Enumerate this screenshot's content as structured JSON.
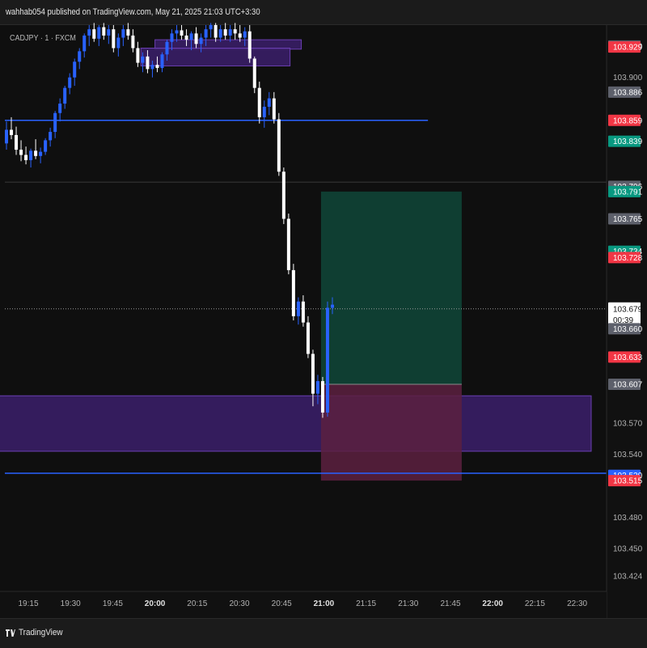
{
  "header": {
    "published": "wahhab054 published on TradingView.com, May 21, 2025 21:03 UTC+3:30"
  },
  "symbol": {
    "label": "CADJPY · 1 · FXCM"
  },
  "footer": {
    "brand": "TradingView",
    "logo_icon": "tradingview-logo-icon"
  },
  "colors": {
    "background": "#0f0f0f",
    "bull": "#2962ff",
    "bear": "#ffffff",
    "level_line": "#2962ff",
    "zone": "#3b1e6b",
    "zone_border": "#6a3fb0",
    "profit": "#0f4638",
    "loss": "#5c2040",
    "tag_red": "#f23645",
    "tag_green": "#089981",
    "tag_gray": "#5d606b",
    "tag_blue": "#2962ff"
  },
  "chart_data": {
    "type": "candlestick",
    "symbol": "CADJPY",
    "interval": "1",
    "source": "FXCM",
    "ylim": [
      103.41,
      103.95
    ],
    "x_ticks": [
      "19:15",
      "19:30",
      "19:45",
      "20:00",
      "20:15",
      "20:30",
      "20:45",
      "21:00",
      "21:15",
      "21:30",
      "21:45",
      "22:00",
      "22:15",
      "22:30"
    ],
    "x_ticks_bold": [
      "20:00",
      "21:00",
      "22:00"
    ],
    "y_ticks": [
      103.9,
      103.57,
      103.54,
      103.48,
      103.45,
      103.424
    ],
    "price_tags": [
      {
        "value": 103.93,
        "label": "103.930",
        "style": "gray"
      },
      {
        "value": 103.929,
        "label": "103.929",
        "style": "red"
      },
      {
        "value": 103.886,
        "label": "103.886",
        "style": "gray"
      },
      {
        "value": 103.859,
        "label": "103.859",
        "style": "red"
      },
      {
        "value": 103.839,
        "label": "103.839",
        "style": "green"
      },
      {
        "value": 103.796,
        "label": "103.796",
        "style": "gray"
      },
      {
        "value": 103.791,
        "label": "103.791",
        "style": "green"
      },
      {
        "value": 103.765,
        "label": "103.765",
        "style": "gray"
      },
      {
        "value": 103.734,
        "label": "103.734",
        "style": "green"
      },
      {
        "value": 103.728,
        "label": "103.728",
        "style": "red"
      },
      {
        "value": 103.679,
        "label": "103.679",
        "sub": "00:39",
        "style": "current"
      },
      {
        "value": 103.66,
        "label": "103.660",
        "style": "gray"
      },
      {
        "value": 103.633,
        "label": "103.633",
        "style": "red"
      },
      {
        "value": 103.607,
        "label": "103.607",
        "style": "gray"
      },
      {
        "value": 103.52,
        "label": "103.520",
        "style": "blue"
      },
      {
        "value": 103.515,
        "label": "103.515",
        "style": "red"
      }
    ],
    "horizontal_lines": [
      {
        "value": 103.859,
        "end_time": "21:37",
        "style": "blue"
      },
      {
        "value": 103.522,
        "end_time": "end",
        "style": "blue"
      },
      {
        "value": 103.8,
        "end_time": "end",
        "style": "gray-thin"
      },
      {
        "value": 103.679,
        "end_time": "end",
        "style": "dotted"
      }
    ],
    "zones": [
      {
        "t0": "20:00",
        "t1": "20:52",
        "top": 103.936,
        "bottom": 103.927
      },
      {
        "t0": "19:55",
        "t1": "20:48",
        "top": 103.928,
        "bottom": 103.911
      },
      {
        "t0": "18:58",
        "t1": "22:35",
        "top": 103.596,
        "bottom": 103.543
      }
    ],
    "position": {
      "side": "long",
      "t0": "20:59",
      "t1": "21:49",
      "entry": 103.607,
      "target": 103.791,
      "stop": 103.515
    },
    "candles": [
      [
        103.837,
        103.858,
        103.831,
        103.85
      ],
      [
        103.85,
        103.862,
        103.841,
        103.845
      ],
      [
        103.845,
        103.853,
        103.826,
        103.831
      ],
      [
        103.831,
        103.84,
        103.82,
        103.826
      ],
      [
        103.826,
        103.834,
        103.817,
        103.821
      ],
      [
        103.821,
        103.832,
        103.814,
        103.83
      ],
      [
        103.83,
        103.841,
        103.822,
        103.825
      ],
      [
        103.825,
        103.833,
        103.818,
        103.829
      ],
      [
        103.829,
        103.842,
        103.826,
        103.84
      ],
      [
        103.84,
        103.852,
        103.834,
        103.848
      ],
      [
        103.848,
        103.868,
        103.842,
        103.866
      ],
      [
        103.866,
        103.88,
        103.858,
        103.875
      ],
      [
        103.875,
        103.892,
        103.87,
        103.89
      ],
      [
        103.89,
        103.904,
        103.884,
        103.9
      ],
      [
        103.9,
        103.918,
        103.892,
        103.915
      ],
      [
        103.915,
        103.928,
        103.908,
        103.925
      ],
      [
        103.925,
        103.942,
        103.919,
        103.94
      ],
      [
        103.94,
        103.95,
        103.93,
        103.946
      ],
      [
        103.946,
        103.952,
        103.934,
        103.937
      ],
      [
        103.937,
        103.95,
        103.93,
        103.948
      ],
      [
        103.948,
        103.952,
        103.936,
        103.94
      ],
      [
        103.94,
        103.95,
        103.932,
        103.946
      ],
      [
        103.946,
        103.95,
        103.924,
        103.928
      ],
      [
        103.928,
        103.942,
        103.92,
        103.938
      ],
      [
        103.938,
        103.95,
        103.93,
        103.946
      ],
      [
        103.946,
        103.952,
        103.936,
        103.94
      ],
      [
        103.94,
        103.946,
        103.924,
        103.928
      ],
      [
        103.928,
        103.934,
        103.91,
        103.914
      ],
      [
        103.914,
        103.924,
        103.905,
        103.92
      ],
      [
        103.92,
        103.926,
        103.904,
        103.908
      ],
      [
        103.908,
        103.916,
        103.9,
        103.912
      ],
      [
        103.912,
        103.92,
        103.905,
        103.909
      ],
      [
        103.909,
        103.924,
        103.905,
        103.922
      ],
      [
        103.922,
        103.936,
        103.916,
        103.934
      ],
      [
        103.934,
        103.946,
        103.926,
        103.942
      ],
      [
        103.942,
        103.95,
        103.934,
        103.945
      ],
      [
        103.945,
        103.95,
        103.936,
        103.94
      ],
      [
        103.94,
        103.946,
        103.93,
        103.936
      ],
      [
        103.936,
        103.944,
        103.926,
        103.942
      ],
      [
        103.942,
        103.948,
        103.928,
        103.932
      ],
      [
        103.932,
        103.942,
        103.924,
        103.938
      ],
      [
        103.938,
        103.95,
        103.93,
        103.946
      ],
      [
        103.946,
        103.952,
        103.938,
        103.95
      ],
      [
        103.95,
        103.952,
        103.934,
        103.938
      ],
      [
        103.938,
        103.95,
        103.934,
        103.946
      ],
      [
        103.946,
        103.952,
        103.936,
        103.94
      ],
      [
        103.94,
        103.95,
        103.934,
        103.946
      ],
      [
        103.946,
        103.952,
        103.936,
        103.942
      ],
      [
        103.942,
        103.95,
        103.934,
        103.938
      ],
      [
        103.938,
        103.948,
        103.93,
        103.944
      ],
      [
        103.944,
        103.95,
        103.914,
        103.918
      ],
      [
        103.918,
        103.92,
        103.885,
        103.89
      ],
      [
        103.89,
        103.896,
        103.856,
        103.862
      ],
      [
        103.862,
        103.878,
        103.852,
        103.872
      ],
      [
        103.872,
        103.886,
        103.864,
        103.88
      ],
      [
        103.88,
        103.886,
        103.856,
        103.86
      ],
      [
        103.86,
        103.866,
        103.806,
        103.81
      ],
      [
        103.81,
        103.814,
        103.76,
        103.765
      ],
      [
        103.765,
        103.77,
        103.712,
        103.716
      ],
      [
        103.716,
        103.722,
        103.668,
        103.672
      ],
      [
        103.672,
        103.69,
        103.664,
        103.686
      ],
      [
        103.686,
        103.692,
        103.662,
        103.666
      ],
      [
        103.666,
        103.672,
        103.632,
        103.636
      ],
      [
        103.636,
        103.64,
        103.586,
        103.598
      ],
      [
        103.598,
        103.616,
        103.588,
        103.61
      ],
      [
        103.61,
        103.614,
        103.575,
        103.58
      ],
      [
        103.58,
        103.686,
        103.576,
        103.68
      ],
      [
        103.68,
        103.69,
        103.674,
        103.683
      ]
    ]
  }
}
